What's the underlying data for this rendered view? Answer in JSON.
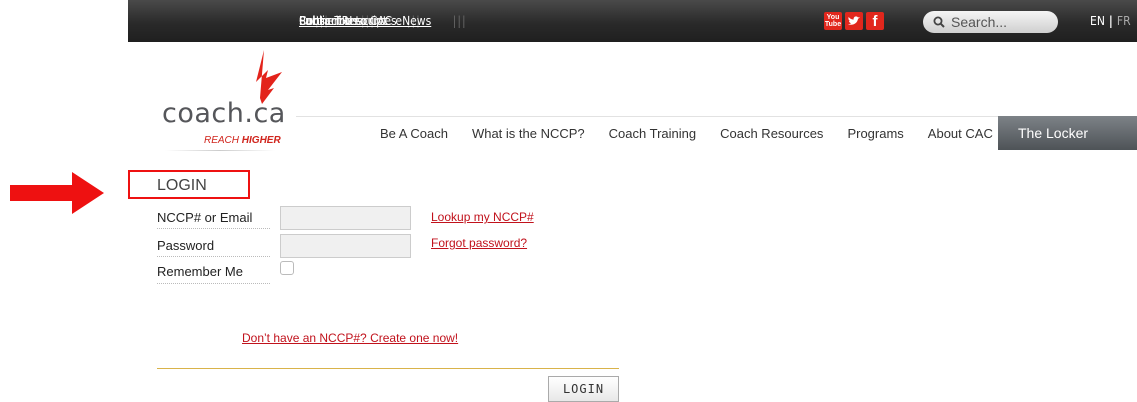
{
  "topbar": {
    "links": [
      "Partner Resources",
      "Subscribe to CAC eNews",
      "Contact Us",
      "Public Transcript"
    ],
    "separator": "|||",
    "social": [
      "youtube-icon",
      "twitter-icon",
      "facebook-icon"
    ],
    "search_placeholder": "Search...",
    "lang_en": "EN",
    "lang_sep": "|",
    "lang_fr": "FR"
  },
  "logo": {
    "word": "coach.ca",
    "tag_prefix": "REACH ",
    "tag_bold": "HIGHER"
  },
  "nav": {
    "items": [
      "Be A Coach",
      "What is the NCCP?",
      "Coach Training",
      "Coach Resources",
      "Programs",
      "About CAC"
    ],
    "locker": "The Locker"
  },
  "login": {
    "title": "LOGIN",
    "id_label": "NCCP# or Email",
    "password_label": "Password",
    "remember_label": "Remember Me",
    "lookup_link": "Lookup my NCCP#",
    "forgot_link": "Forgot password?",
    "create_link": "Don’t have an NCCP#? Create one now!",
    "submit": "LOGIN"
  },
  "colors": {
    "accent": "#e11111",
    "link": "#c1121c",
    "topbar": "#2a2a2a"
  }
}
